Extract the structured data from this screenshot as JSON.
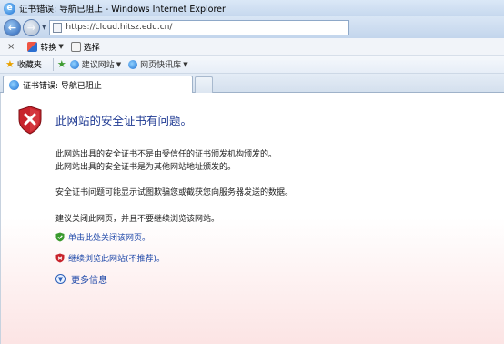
{
  "window": {
    "title": "证书错误: 导航已阻止 - Windows Internet Explorer"
  },
  "address": {
    "url": "https://cloud.hitsz.edu.cn/"
  },
  "command_bar": {
    "close_glyph": "×",
    "translate_label": "转换",
    "select_label": "选择"
  },
  "favorites_bar": {
    "favorites_label": "收藏夹",
    "suggested_sites_label": "建议网站",
    "web_slice_gallery_label": "网页快讯库"
  },
  "tab": {
    "active_label": "证书错误: 导航已阻止"
  },
  "error_page": {
    "headline": "此网站的安全证书有问题。",
    "line1": "此网站出具的安全证书不是由受信任的证书颁发机构颁发的。",
    "line2": "此网站出具的安全证书是为其他网站地址颁发的。",
    "line3": "安全证书问题可能显示试图欺骗您或截获您向服务器发送的数据。",
    "line4": "建议关闭此网页，并且不要继续浏览该网站。",
    "close_page_link": "单击此处关闭该网页。",
    "continue_link": "继续浏览此网站(不推荐)。",
    "more_info": "更多信息"
  },
  "colors": {
    "link_blue": "#1d47a8",
    "headline_blue": "#1f3a93",
    "shield_red": "#c8232c",
    "shield_green": "#3a9a2e"
  }
}
